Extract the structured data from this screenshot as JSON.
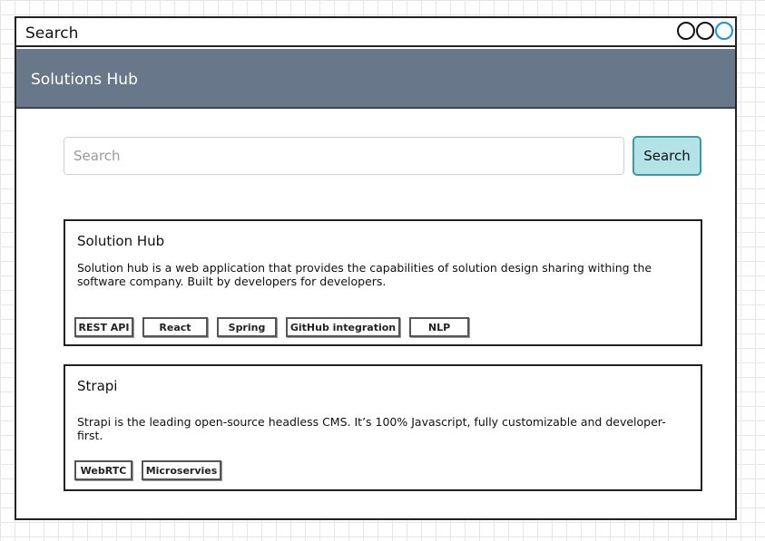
{
  "window": {
    "title": "Search",
    "controls": [
      "minimize",
      "maximize",
      "close"
    ]
  },
  "app": {
    "title": "Solutions Hub"
  },
  "search": {
    "placeholder": "Search",
    "value": "",
    "button_label": "Search"
  },
  "results": [
    {
      "title": "Solution Hub",
      "description": "Solution hub is a web application that provides the capabilities of solution design sharing withing the software company. Built by developers for developers.",
      "tags": [
        "REST API",
        "React",
        "Spring",
        "GitHub integration",
        "NLP"
      ]
    },
    {
      "title": "Strapi",
      "description": "Strapi is the leading open-source headless CMS. It’s 100% Javascript, fully customizable and developer-first.",
      "tags": [
        "WebRTC",
        "Microservies"
      ]
    }
  ],
  "colors": {
    "appbar": "#687789",
    "search_button_bg": "#b3e2e7",
    "search_button_border": "#3a9aa1",
    "active_control": "#1a8fe3"
  }
}
